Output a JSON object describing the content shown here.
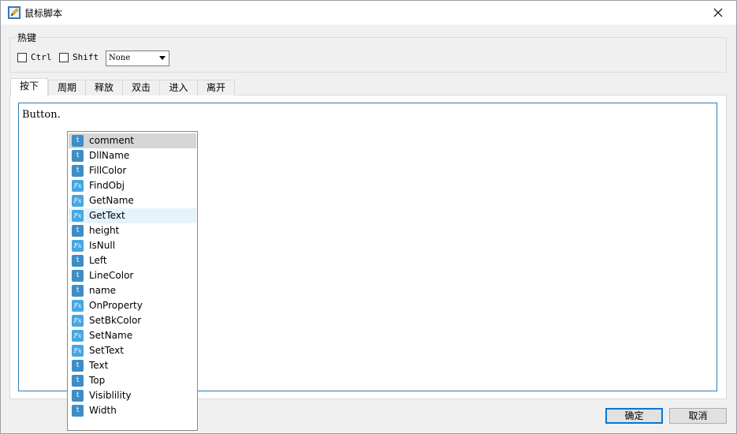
{
  "window": {
    "title": "鼠标脚本"
  },
  "hotkey": {
    "group_title": "热键",
    "ctrl_label": "Ctrl",
    "shift_label": "Shift",
    "key_select_value": "None"
  },
  "tabs": [
    {
      "label": "按下"
    },
    {
      "label": "周期"
    },
    {
      "label": "释放"
    },
    {
      "label": "双击"
    },
    {
      "label": "进入"
    },
    {
      "label": "离开"
    }
  ],
  "editor": {
    "text": "Button."
  },
  "autocomplete": {
    "items": [
      {
        "label": "comment",
        "kind": "t"
      },
      {
        "label": "DllName",
        "kind": "t"
      },
      {
        "label": "FillColor",
        "kind": "t"
      },
      {
        "label": "FindObj",
        "kind": "Fx"
      },
      {
        "label": "GetName",
        "kind": "Fx"
      },
      {
        "label": "GetText",
        "kind": "Fx"
      },
      {
        "label": "height",
        "kind": "t"
      },
      {
        "label": "IsNull",
        "kind": "Fx"
      },
      {
        "label": "Left",
        "kind": "t"
      },
      {
        "label": "LineColor",
        "kind": "t"
      },
      {
        "label": "name",
        "kind": "t"
      },
      {
        "label": "OnProperty",
        "kind": "Fx"
      },
      {
        "label": "SetBkColor",
        "kind": "Fx"
      },
      {
        "label": "SetName",
        "kind": "Fx"
      },
      {
        "label": "SetText",
        "kind": "Fx"
      },
      {
        "label": "Text",
        "kind": "t"
      },
      {
        "label": "Top",
        "kind": "t"
      },
      {
        "label": "Visiblility",
        "kind": "t"
      },
      {
        "label": "Width",
        "kind": "t"
      }
    ]
  },
  "buttons": {
    "ok_label": "确定",
    "cancel_label": "取消"
  },
  "colors": {
    "accent": "#0078d7",
    "editor_border": "#2d7db3",
    "item_icon": "#3d8dc7"
  }
}
